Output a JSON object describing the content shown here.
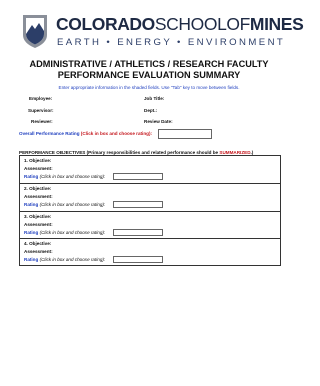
{
  "logo": {
    "name_bold": "COLORADO",
    "name_light": "SCHOOL",
    "name_of": "OF",
    "name_mines": "MINES",
    "tagline": "EARTH • ENERGY • ENVIRONMENT",
    "colors": {
      "navy": "#1e2a44",
      "mark_gray": "#8a8f99",
      "mark_blue": "#2c3e68"
    },
    "icon": "mountain-shield-icon"
  },
  "title": {
    "line1": "ADMINISTRATIVE / ATHLETICS / RESEARCH FACULTY",
    "line2": "PERFORMANCE EVALUATION SUMMARY"
  },
  "instructions": "Enter appropriate information in the shaded fields.  Use \"Tab\" key to move between fields.",
  "fields": {
    "employee": "Employee:",
    "job_title": "Job Title:",
    "supervisor": "Supervisor:",
    "dept": "Dept.:",
    "reviewer": "Reviewer:",
    "review_date": "Review Date:"
  },
  "overall": {
    "label_blue": "Overall Performance Rating",
    "label_red": "(Click in box and choose rating):"
  },
  "objectives_header": {
    "prefix": "PERFORMANCE OBJECTIVES (Primary responsibilities and related performance should be ",
    "emph": "SUMMARIZED",
    "suffix": ".)"
  },
  "objectives": [
    {
      "objective": "1.  Objective:",
      "assessment": "Assessment:",
      "rating_label": "Rating",
      "rating_hint": "(Click in box and choose rating):"
    },
    {
      "objective": "2.  Objective:",
      "assessment": "Assessment:",
      "rating_label": "Rating",
      "rating_hint": "(Click in box and choose rating):"
    },
    {
      "objective": "3.  Objective:",
      "assessment": "Assessment:",
      "rating_label": "Rating",
      "rating_hint": "(Click in box and choose rating):"
    },
    {
      "objective": "4.  Objective:",
      "assessment": "Assessment:",
      "rating_label": "Rating",
      "rating_hint": "(Click in box and choose rating):"
    }
  ]
}
